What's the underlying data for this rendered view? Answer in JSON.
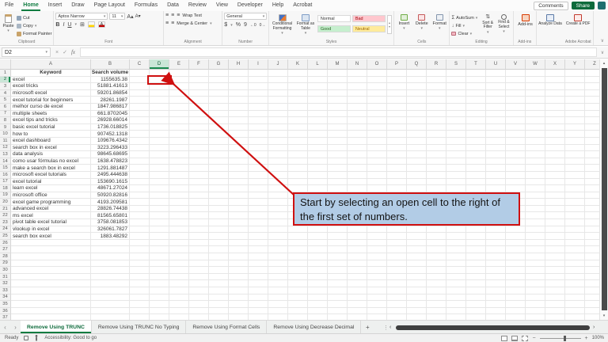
{
  "ribbon": {
    "tabs": [
      {
        "label": "File",
        "active": false
      },
      {
        "label": "Home",
        "active": true
      },
      {
        "label": "Insert",
        "active": false
      },
      {
        "label": "Draw",
        "active": false
      },
      {
        "label": "Page Layout",
        "active": false
      },
      {
        "label": "Formulas",
        "active": false
      },
      {
        "label": "Data",
        "active": false
      },
      {
        "label": "Review",
        "active": false
      },
      {
        "label": "View",
        "active": false
      },
      {
        "label": "Developer",
        "active": false
      },
      {
        "label": "Help",
        "active": false
      },
      {
        "label": "Acrobat",
        "active": false
      }
    ],
    "top_right": {
      "comments": "Comments",
      "share": "Share"
    },
    "clipboard": {
      "label": "Clipboard",
      "paste": "Paste",
      "cut": "Cut",
      "copy": "Copy",
      "format_painter": "Format Painter"
    },
    "font": {
      "label": "Font",
      "font_name": "Aptos Narrow",
      "font_size": "11",
      "bold": "B",
      "italic": "I",
      "underline": "U"
    },
    "alignment": {
      "label": "Alignment",
      "wrap_text": "Wrap Text",
      "merge_center": "Merge & Center"
    },
    "number": {
      "label": "Number",
      "format": "General",
      "currency": "$",
      "percent": "%",
      "comma": "9"
    },
    "styles": {
      "label": "Styles",
      "conditional": "Conditional Formatting",
      "format_table": "Format as Table",
      "gallery": [
        {
          "label": "Normal",
          "bg": "#ffffff",
          "fg": "#333333"
        },
        {
          "label": "Bad",
          "bg": "#ffc7ce",
          "fg": "#9c0006"
        },
        {
          "label": "Good",
          "bg": "#c6efce",
          "fg": "#276221"
        },
        {
          "label": "Neutral",
          "bg": "#ffeb9c",
          "fg": "#9c6500"
        }
      ]
    },
    "cells": {
      "label": "Cells",
      "insert": "Insert",
      "delete": "Delete",
      "format": "Format"
    },
    "editing": {
      "label": "Editing",
      "autosum": "AutoSum",
      "fill": "Fill",
      "clear": "Clear",
      "sort_filter": "Sort & Filter",
      "find_select": "Find & Select"
    },
    "addins": {
      "label": "Add-ins",
      "addins": "Add-ins",
      "analyze": "Analyze Data"
    },
    "acrobat": {
      "label": "Adobe Acrobat",
      "create_pdf": "Create a PDF"
    }
  },
  "formula_bar": {
    "name_box": "D2",
    "fx_label": "fx",
    "formula": ""
  },
  "sheet": {
    "columns": [
      "A",
      "B",
      "C",
      "D",
      "E",
      "F",
      "G",
      "H",
      "I",
      "J",
      "K",
      "L",
      "M",
      "N",
      "O",
      "P",
      "Q",
      "R",
      "S",
      "T",
      "U",
      "V",
      "W",
      "X",
      "Y",
      "Z"
    ],
    "selected_cell": "D2",
    "selected_column": "D",
    "selected_row": 2,
    "visible_rows": 37,
    "col_headers": {
      "A": "Keyword",
      "B": "Search volume"
    },
    "data": [
      [
        "excel",
        "1155635.38"
      ],
      [
        "excel tricks",
        "51881.41613"
      ],
      [
        "microsoft excel",
        "59201.86854"
      ],
      [
        "excel tutorial for beginners",
        "28261.1987"
      ],
      [
        "melhor curso de excel",
        "1847.986817"
      ],
      [
        "multiple sheets",
        "661.8702045"
      ],
      [
        "excel tips and tricks",
        "26928.66014"
      ],
      [
        "basic excel tutorial",
        "1736.018825"
      ],
      [
        "how to",
        "907452.1318"
      ],
      [
        "excel dashboard",
        "109676.4342"
      ],
      [
        "search box in excel",
        "3223.296433"
      ],
      [
        "data analysis",
        "98645.68695"
      ],
      [
        "como usar fórmulas no excel",
        "1638.478823"
      ],
      [
        "make a search box in excel",
        "1291.881487"
      ],
      [
        "microsoft excel tutorials",
        "2495.444638"
      ],
      [
        "excel tutorial",
        "153690.1615"
      ],
      [
        "learn excel",
        "48671.27024"
      ],
      [
        "microsoft office",
        "50920.82816"
      ],
      [
        "excel game programming",
        "4193.209581"
      ],
      [
        "advanced excel",
        "28826.74438"
      ],
      [
        "ms excel",
        "81565.65801"
      ],
      [
        "pivot table excel tutorial",
        "3758.081853"
      ],
      [
        "vlookup in excel",
        "326061.7827"
      ],
      [
        "search box excel",
        "1883.48292"
      ]
    ]
  },
  "annotation": {
    "callout_text": "Start by selecting an open cell to the right of the first set of numbers.",
    "accent_color": "#cf1010",
    "callout_bg": "#b2cce6"
  },
  "sheet_tabs": {
    "tabs": [
      {
        "label": "Remove Using TRUNC",
        "active": true
      },
      {
        "label": "Remove Using TRUNC No Typing",
        "active": false
      },
      {
        "label": "Remove Using Format Cells",
        "active": false
      },
      {
        "label": "Remove Using Decrease Decimal",
        "active": false
      }
    ],
    "add_label": "+"
  },
  "status_bar": {
    "ready": "Ready",
    "accessibility": "Accessibility: Good to go",
    "zoom_level": "100%"
  }
}
